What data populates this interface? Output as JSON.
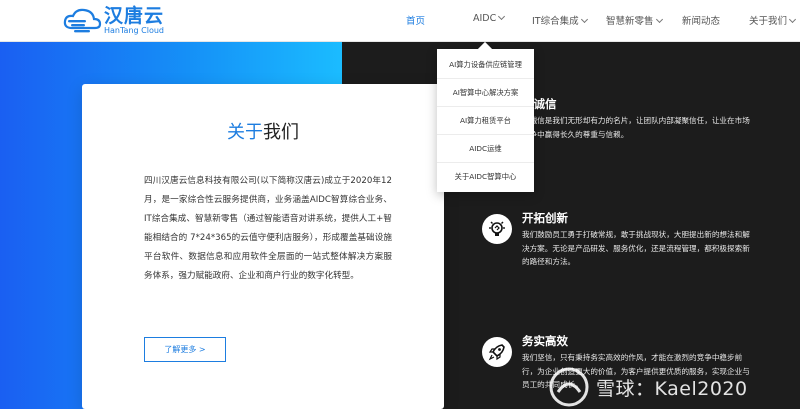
{
  "brand": {
    "name_cn": "汉唐云",
    "name_en": "HanTang Cloud",
    "primary_color": "#1d7de0"
  },
  "nav": {
    "items": [
      {
        "label": "首页",
        "active": true
      },
      {
        "label": "AIDC",
        "has_dropdown": true
      },
      {
        "label": "IT综合集成",
        "has_dropdown": true
      },
      {
        "label": "智慧新零售",
        "has_dropdown": true
      },
      {
        "label": "新闻动态"
      },
      {
        "label": "关于我们",
        "has_dropdown": true
      }
    ]
  },
  "dropdown": {
    "items": [
      "AI算力设备供应链管理",
      "AI智算中心解决方案",
      "AI算力租赁平台",
      "AIDC运维",
      "关于AIDC智算中心"
    ]
  },
  "about": {
    "title_highlight": "关于",
    "title_rest": "我们",
    "body": "四川汉唐云信息科技有限公司(以下简称汉唐云)成立于2020年12月，是一家综合性云服务提供商，业务涵盖AIDC智算综合业务、IT综合集成、智慧新零售（通过智能语音对讲系统，提供人工+智能相结合的 7*24*365的云值守便利店服务），形成覆盖基础设施平台软件、数据信息和应用软件全层面的一站式整体解决方案服务体系，强力赋能政府、企业和商户行业的数字化转型。",
    "more_label": "了解更多 >"
  },
  "features": [
    {
      "title": "直诚信",
      "desc": "直诚信是我们无形却有力的名片，让团队内部凝聚信任，让业在市场竞争中赢得长久的尊重与信赖。",
      "icon": "handshake-icon"
    },
    {
      "title": "开拓创新",
      "desc": "我们鼓励员工勇于打破常规，敢于挑战现状，大胆提出新的想法和解决方案。无论是产品研发、服务优化，还是流程管理，都积极探索新的路径和方法。",
      "icon": "lightbulb-icon"
    },
    {
      "title": "务实高效",
      "desc": "我们坚信，只有秉持务实高效的作风，才能在激烈的竞争中稳步前行，为企业创造更大的价值，为客户提供更优质的服务，实现企业与员工的共同成长。",
      "icon": "rocket-icon"
    }
  ],
  "watermark": {
    "text": "雪球：Kael2020"
  }
}
